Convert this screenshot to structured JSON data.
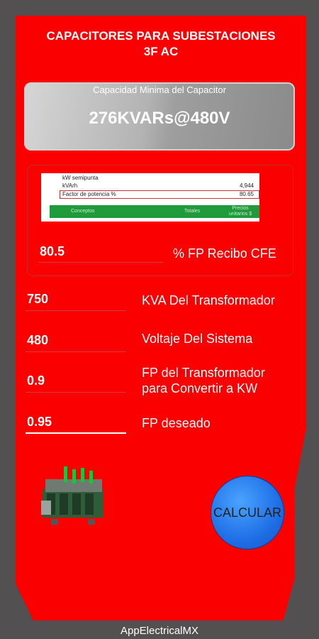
{
  "header": {
    "title_line1": "CAPACITORES PARA SUBESTACIONES",
    "title_line2": "3F AC"
  },
  "result": {
    "label": "Capacidad Minima del Capacitor",
    "value": "276KVARs@480V"
  },
  "receipt": {
    "line1": "kW semipunta",
    "line2": "kVArh",
    "line2_value": "4,944",
    "line3": "Factor de potencia %",
    "line3_value": "80.65",
    "col1": "Conceptos",
    "col2": "Totales",
    "col3": "Precios unitarios $"
  },
  "fields": {
    "fp_recibo": {
      "value": "80.5",
      "label": "% FP Recibo CFE"
    },
    "kva": {
      "value": "750",
      "label": "KVA Del Transformador"
    },
    "voltaje": {
      "value": "480",
      "label": "Voltaje Del Sistema"
    },
    "fp_transformador": {
      "value": "0.9",
      "label_line1": "FP del Transformador",
      "label_line2": "para Convertir a KW"
    },
    "fp_deseado": {
      "value": "0.95",
      "label": "FP deseado"
    }
  },
  "actions": {
    "calculate_label": "CALCULAR"
  },
  "footer": {
    "brand": "AppElectricalMX"
  },
  "colors": {
    "background": "#525050",
    "card": "#fa0000",
    "button": "#1f6fe6"
  }
}
